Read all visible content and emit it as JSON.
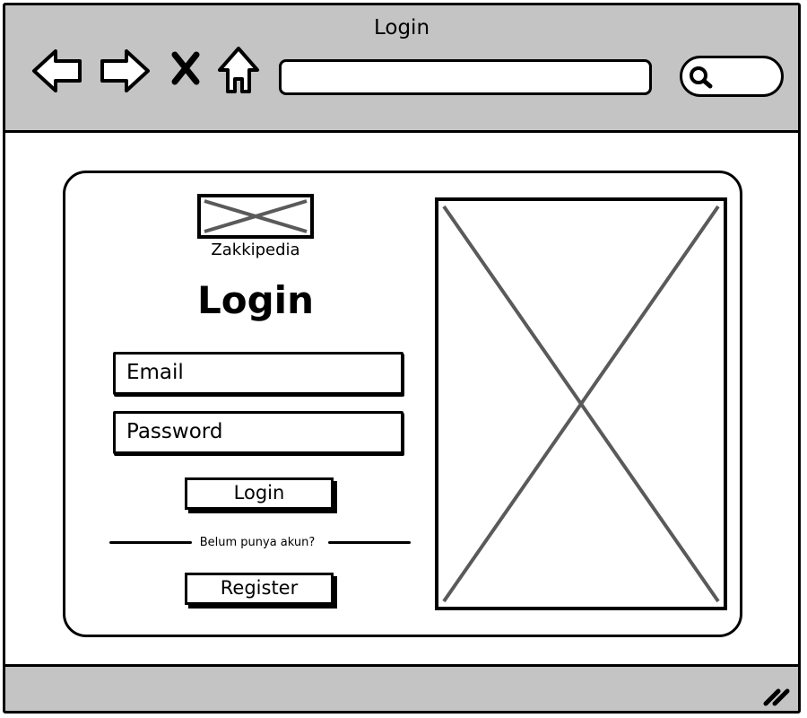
{
  "window": {
    "title": "Login"
  },
  "toolbar": {
    "icons": [
      "back-arrow-icon",
      "forward-arrow-icon",
      "close-x-icon",
      "home-icon",
      "search-icon"
    ],
    "address_value": "",
    "search_value": ""
  },
  "login_card": {
    "brand_name": "Zakkipedia",
    "heading": "Login",
    "email_placeholder": "Email",
    "password_placeholder": "Password",
    "login_button": "Login",
    "separator_text": "Belum punya akun?",
    "register_button": "Register"
  },
  "colors": {
    "chrome_gray": "#c4c4c4",
    "outline": "#000000",
    "placeholder_cross": "#5a5a5a",
    "background": "#ffffff"
  }
}
